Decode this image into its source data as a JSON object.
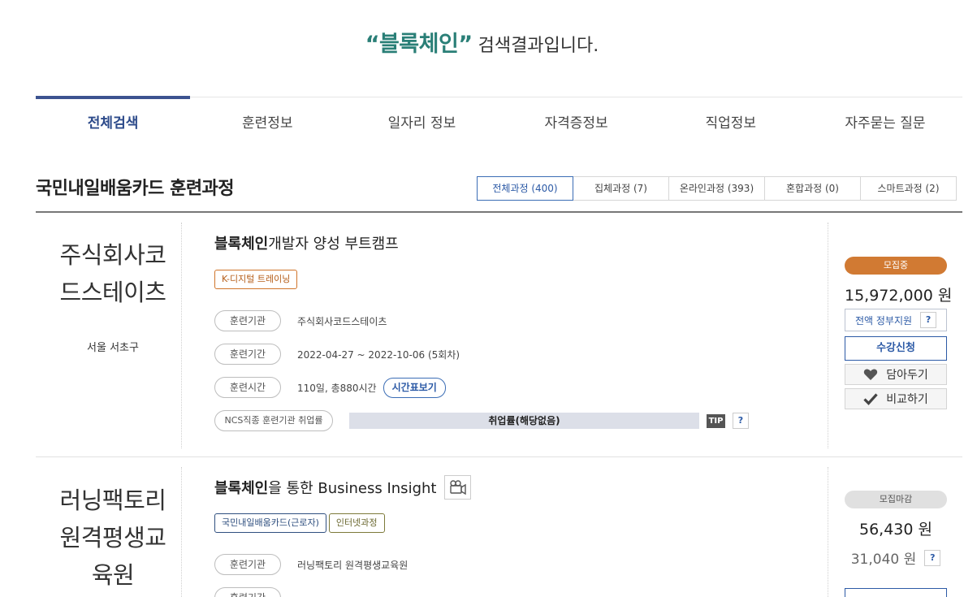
{
  "header": {
    "open_quote": "“",
    "keyword": "블록체인",
    "close_quote": "”",
    "suffix": " 검색결과입니다."
  },
  "tabs": [
    {
      "label": "전체검색",
      "active": true
    },
    {
      "label": "훈련정보"
    },
    {
      "label": "일자리 정보"
    },
    {
      "label": "자격증정보"
    },
    {
      "label": "직업정보"
    },
    {
      "label": "자주묻는 질문"
    }
  ],
  "section": {
    "title": "국민내일배움카드 훈련과정",
    "filters": [
      {
        "label": "전체과정 (400)",
        "active": true
      },
      {
        "label": "집체과정 (7)"
      },
      {
        "label": "온라인과정 (393)"
      },
      {
        "label": "혼합과정 (0)"
      },
      {
        "label": "스마트과정 (2)"
      }
    ]
  },
  "courses": [
    {
      "inst_lines": [
        "주식회사코",
        "드스테이츠"
      ],
      "location": "서울 서초구",
      "title_kw": "블록체인",
      "title_rest": " 개발자 양성 부트캠프",
      "badges": [
        "K-디지털 트레이닝"
      ],
      "label_org": "훈련기관",
      "org": "주식회사코드스테이츠",
      "label_period": "훈련기간",
      "period": "2022-04-27 ~ 2022-10-06 (5회차)",
      "label_hours": "훈련시간",
      "hours": "110일, 총880시간",
      "schedule_btn": "시간표보기",
      "label_rate": "NCS직종 훈련기관 취업률",
      "rate": "취업률(해당없음)",
      "tip": "TIP",
      "qm": "?",
      "status": "모집중",
      "price": "15,972,000 원",
      "gov_support": "전액 정부지원",
      "apply": "수강신청",
      "wish": "담아두기",
      "compare": "비교하기"
    },
    {
      "inst_lines": [
        "러닝팩토리",
        "원격평생교",
        "육원"
      ],
      "title_kw": "블록체인",
      "title_rest": "을 통한 Business Insight",
      "badges": [
        "국민내일배움카드(근로자)",
        "인터넷과정"
      ],
      "label_org": "훈련기관",
      "org": "러닝팩토리 원격평생교육원",
      "label_period": "훈련기간",
      "qm": "?",
      "status": "모집마감",
      "price": "56,430 원",
      "price_sub": "31,040 원"
    }
  ],
  "colors": {
    "keyword": "#2a7f77",
    "tab_active": "#3c5390",
    "status_open": "#d17a33",
    "link_blue": "#2c5aa6"
  },
  "icons": [
    "heart-icon",
    "check-icon",
    "video-camera-icon"
  ]
}
